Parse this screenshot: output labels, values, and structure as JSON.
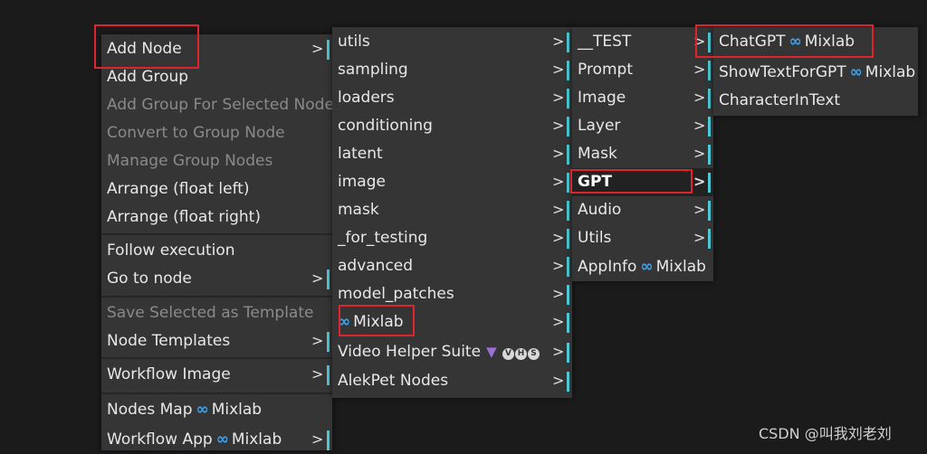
{
  "main_menu": {
    "add_node": "Add Node",
    "add_group": "Add Group",
    "add_group_selected": "Add Group For Selected Nodes",
    "convert_group": "Convert to Group Node",
    "manage_group": "Manage Group Nodes",
    "arrange_left": "Arrange (float left)",
    "arrange_right": "Arrange (float right)",
    "follow_execution": "Follow execution",
    "go_to_node": "Go to node",
    "save_template": "Save Selected as Template",
    "node_templates": "Node Templates",
    "workflow_image": "Workflow Image",
    "nodes_map": "Nodes Map",
    "workflow_app": "Workflow App",
    "mixlab_tag": "Mixlab"
  },
  "category_menu": {
    "items": [
      "utils",
      "sampling",
      "loaders",
      "conditioning",
      "latent",
      "image",
      "mask",
      "_for_testing",
      "advanced",
      "model_patches"
    ],
    "mixlab": "Mixlab",
    "video_helper": "Video Helper Suite",
    "video_badges": [
      "V",
      "H",
      "S"
    ],
    "alekpet": "AlekPet Nodes"
  },
  "mixlab_menu": {
    "items": [
      "__TEST",
      "Prompt",
      "Image",
      "Layer",
      "Mask",
      "GPT",
      "Audio",
      "Utils"
    ],
    "appinfo": "AppInfo",
    "mixlab_tag": "Mixlab"
  },
  "gpt_menu": {
    "chatgpt": "ChatGPT",
    "showtext": "ShowTextForGPT",
    "character": "CharacterInText",
    "mixlab_tag": "Mixlab"
  },
  "symbols": {
    "arrow": ">",
    "infinity": "∞"
  },
  "watermark": "CSDN @叫我刘老刘",
  "colors": {
    "accent_teal": "#4dc8d4",
    "highlight_red": "#e0242e",
    "infinity_blue": "#3da4f0"
  }
}
